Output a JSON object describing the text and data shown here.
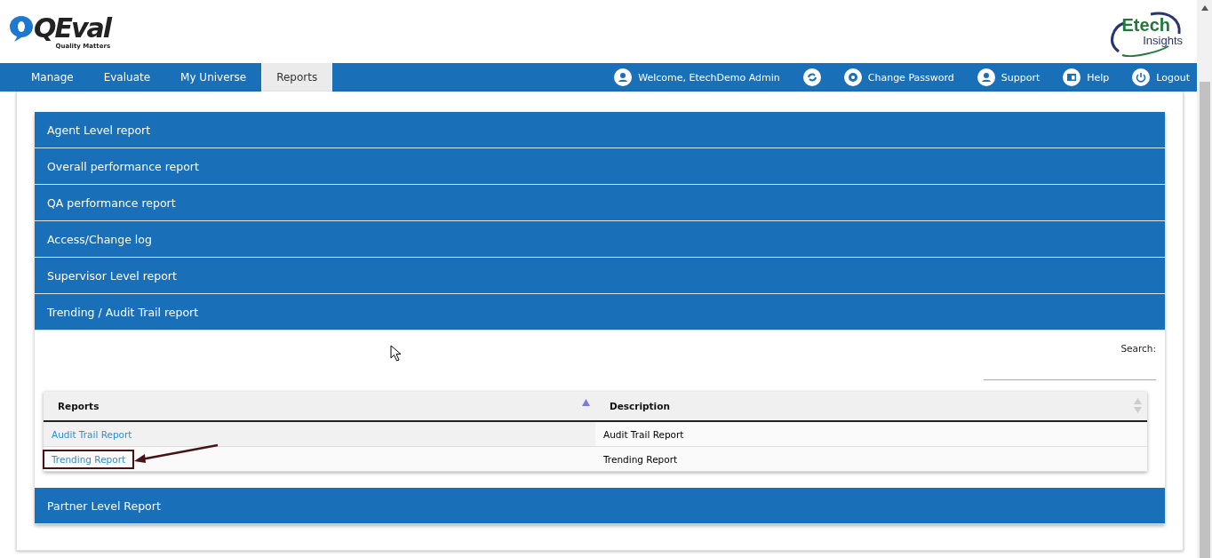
{
  "brand": {
    "name": "QEval",
    "tagline": "Quality Matters",
    "partner_line1": "Etech",
    "partner_line2": "Insights"
  },
  "nav": {
    "tabs": [
      {
        "label": "Manage",
        "selected": false
      },
      {
        "label": "Evaluate",
        "selected": false
      },
      {
        "label": "My Universe",
        "selected": false
      },
      {
        "label": "Reports",
        "selected": true
      }
    ],
    "user_items": [
      {
        "kind": "user",
        "label": "Welcome, EtechDemo Admin"
      },
      {
        "kind": "refresh"
      },
      {
        "kind": "gear",
        "label": "Change Password"
      },
      {
        "kind": "user",
        "label": "Support"
      },
      {
        "kind": "help",
        "label": "Help"
      },
      {
        "kind": "power",
        "label": "Logout"
      }
    ]
  },
  "sections": [
    {
      "title": "Agent Level report"
    },
    {
      "title": "Overall performance report"
    },
    {
      "title": "QA performance report"
    },
    {
      "title": "Access/Change log"
    },
    {
      "title": "Supervisor Level report"
    },
    {
      "title": "Trending / Audit Trail report",
      "content": {
        "search_label": "Search:",
        "columns": [
          {
            "label": "Reports",
            "sorted": true
          },
          {
            "label": "Description",
            "sorted": false
          }
        ],
        "rows": [
          {
            "report": "Audit Trail Report",
            "description": "Audit Trail Report",
            "annotated": false
          },
          {
            "report": "Trending Report",
            "description": "Trending Report",
            "annotated": true
          }
        ]
      }
    },
    {
      "title": "Partner Level Report"
    }
  ]
}
